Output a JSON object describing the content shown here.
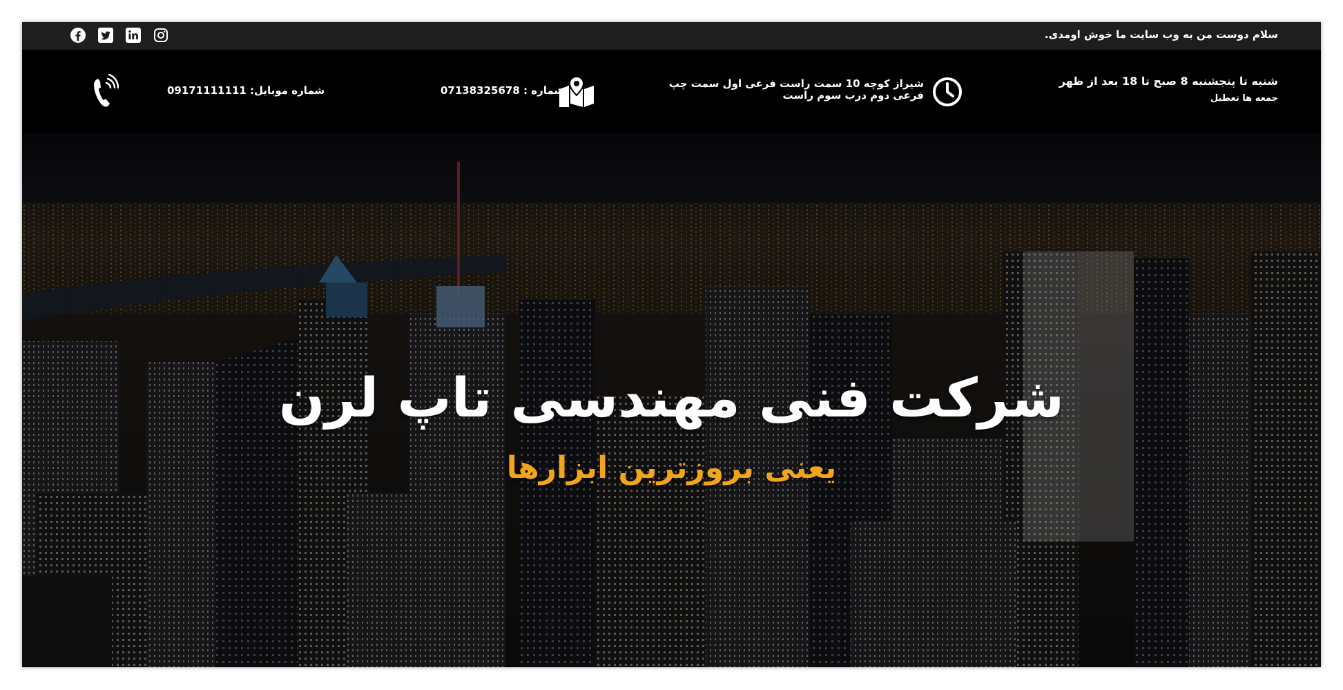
{
  "topbar": {
    "welcome_text": "سلام دوست من به وب سایت ما خوش اومدی.",
    "social_icons": [
      "facebook-icon",
      "twitter-icon",
      "linkedin-icon",
      "instagram-icon"
    ]
  },
  "contact": {
    "hours_line1": "شنبه تا پنجشنبه 8 صبح تا 18 بعد از ظهر",
    "hours_line2": "جمعه ها تعطیل",
    "address_line1": "شیراز کوچه 10 سمت راست فرعی اول سمت چپ",
    "address_line2": "فرعی دوم درب سوم راست",
    "phone_text": "شماره : 07138325678",
    "mobile_text": "شماره موبایل: 09171111111"
  },
  "hero": {
    "title": "شرکت فنی مهندسی تاپ لرن",
    "subtitle": "یعنی بروزترین ابزارها"
  },
  "colors": {
    "topbar_bg": "#1e1e1e",
    "contactbar_bg": "#000000",
    "subtitle_accent": "#f2a51a",
    "text": "#ffffff"
  }
}
